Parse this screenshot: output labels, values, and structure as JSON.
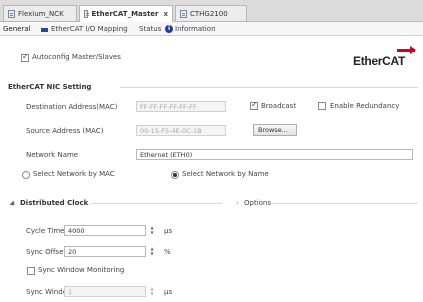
{
  "tabs": [
    {
      "label": "Flexium_NCK"
    },
    {
      "label": "EtherCAT_Master",
      "close": "x"
    },
    {
      "label": "CTHG2100"
    }
  ],
  "subtabs": [
    {
      "label": "General"
    },
    {
      "label": "EtherCAT I/O Mapping"
    },
    {
      "label": "Status"
    },
    {
      "label": "Information"
    }
  ],
  "autoconfig_label": "Autoconfig Master/Slaves",
  "logo": {
    "text": "EtherCAT",
    "accent_color": "#d6001c"
  },
  "nic": {
    "title": "EtherCAT NIC Setting",
    "dest_label": "Destination Address(MAC)",
    "dest_value": "FF-FF-FF-FF-FF-FF",
    "broadcast_label": "Broadcast",
    "redundancy_label": "Enable Redundancy",
    "source_label": "Source Address (MAC)",
    "source_value": "00-15-F5-4E-0C-1B",
    "browse_label": "Browse...",
    "network_name_label": "Network Name",
    "network_name_value": "Ethernet (ETH0)",
    "select_mac_label": "Select Network by MAC",
    "select_name_label": "Select Network by Name"
  },
  "dc": {
    "title": "Distributed Clock",
    "cycle_time_label": "Cycle Time",
    "cycle_time_value": "4000",
    "cycle_time_unit": "µs",
    "sync_offset_label": "Sync Offset",
    "sync_offset_value": "20",
    "sync_offset_unit": "%",
    "sync_window_monitoring_label": "Sync Window Monitoring",
    "sync_window_label": "Sync Window",
    "sync_window_value": "1",
    "sync_window_unit": "µs"
  },
  "options": {
    "title": "Options"
  }
}
